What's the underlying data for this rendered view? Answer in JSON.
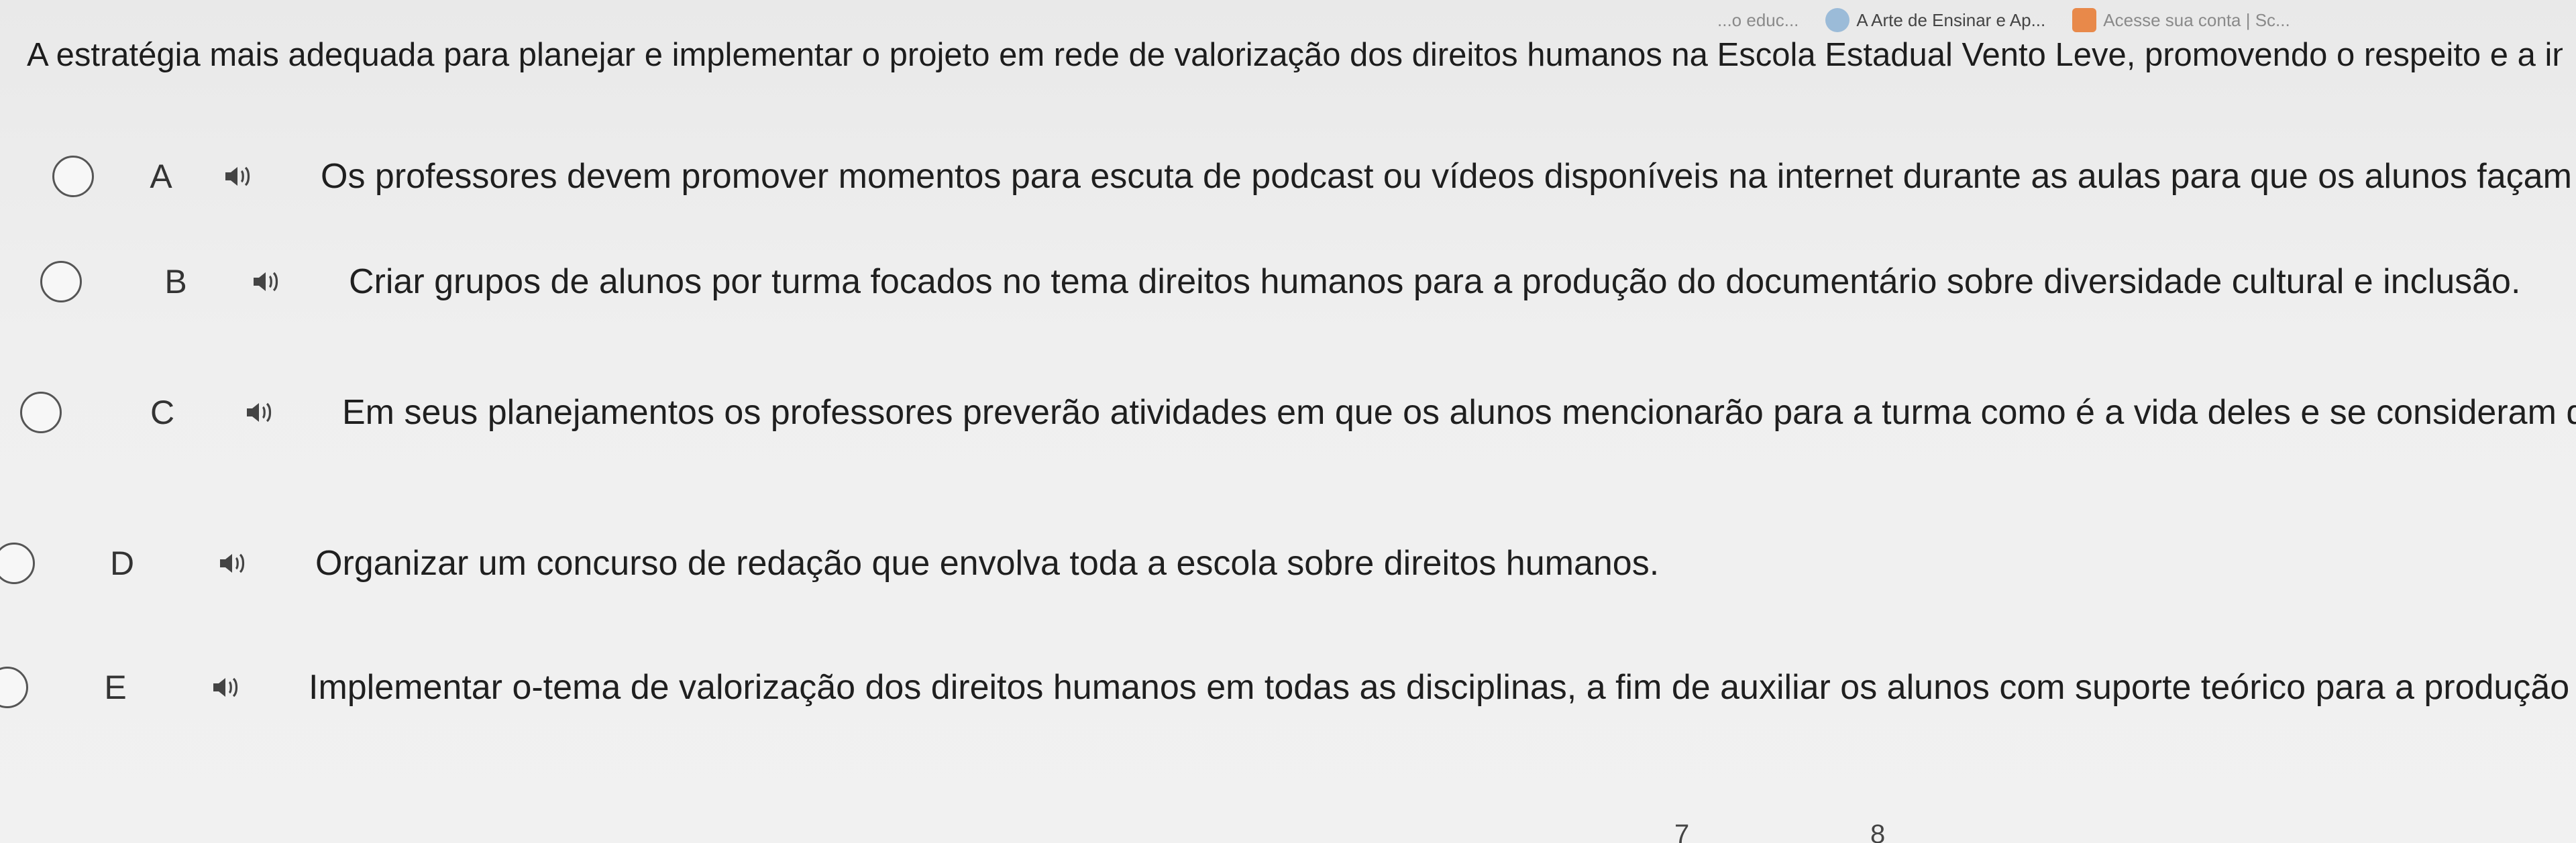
{
  "browser": {
    "tabs": [
      {
        "label": "...o educ...",
        "icon": "page-icon"
      },
      {
        "label": "A Arte de Ensinar e Ap...",
        "icon": "globe-icon"
      },
      {
        "label": "Acesse sua conta | Sc...",
        "icon": "bookmark-icon"
      }
    ]
  },
  "question": {
    "text": "A estratégia mais adequada para planejar e implementar o projeto em rede de valorização dos direitos humanos na Escola Estadual Vento Leve, promovendo o respeito e a inclusão, seria:"
  },
  "options": [
    {
      "letter": "A",
      "text": "Os professores devem promover momentos para escuta de podcast ou vídeos disponíveis na internet durante as aulas para que os alunos façam suas reflexões."
    },
    {
      "letter": "B",
      "text": "Criar grupos de alunos por turma focados no tema direitos humanos para a produção do documentário sobre diversidade cultural e inclusão."
    },
    {
      "letter": "C",
      "text": "Em seus planejamentos os professores preverão atividades em que os alunos mencionarão para a turma como é a vida deles e se consideram que já foram lesados algum"
    },
    {
      "letter": "D",
      "text": "Organizar um concurso de redação que envolva toda a escola sobre direitos humanos."
    },
    {
      "letter": "E",
      "text": "Implementar o-tema de valorização dos direitos humanos em todas as disciplinas, a fim de auxiliar os alunos com suporte teórico para a produção do documentário."
    }
  ],
  "footer": {
    "page_numbers": [
      "7",
      "8"
    ]
  }
}
